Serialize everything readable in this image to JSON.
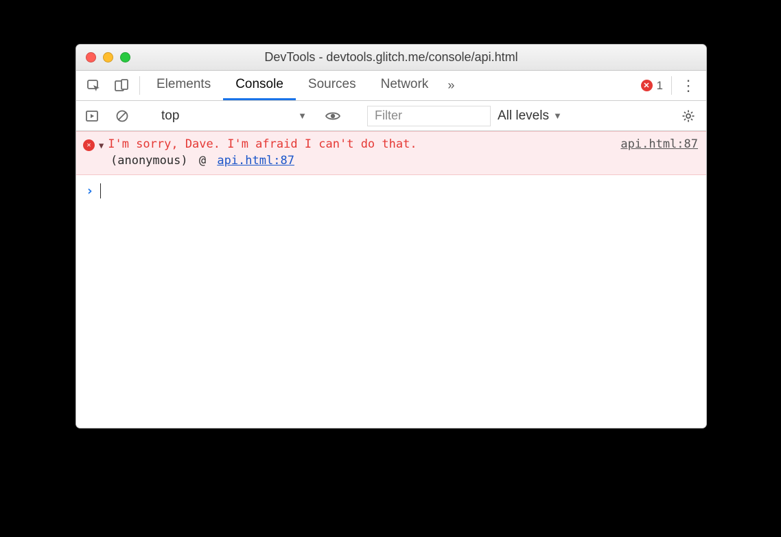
{
  "window": {
    "title": "DevTools - devtools.glitch.me/console/api.html"
  },
  "tabs": {
    "items": [
      "Elements",
      "Console",
      "Sources",
      "Network"
    ],
    "active": "Console",
    "overflow_glyph": "»"
  },
  "errors": {
    "count": "1"
  },
  "toolbar": {
    "context": "top",
    "filter_placeholder": "Filter",
    "levels_label": "All levels"
  },
  "console": {
    "entries": [
      {
        "type": "error",
        "message": "I'm sorry, Dave. I'm afraid I can't do that.",
        "source": "api.html:87",
        "trace_func": "(anonymous)",
        "trace_at": "@",
        "trace_link": "api.html:87"
      }
    ]
  }
}
